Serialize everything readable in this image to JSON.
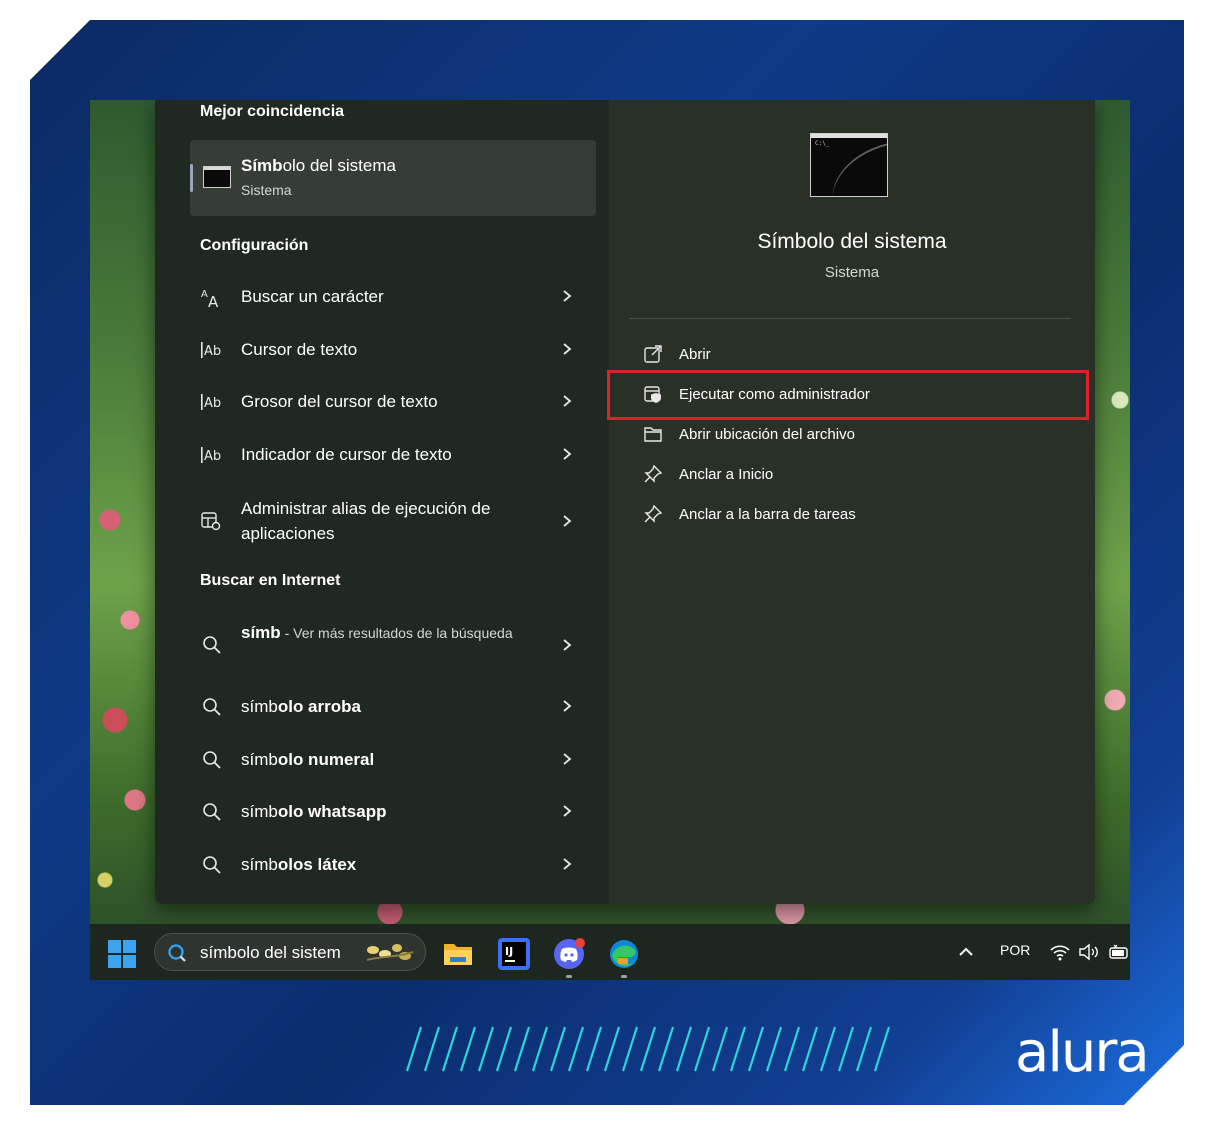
{
  "left": {
    "best_match_title": "Mejor coincidencia",
    "best_match": {
      "name": "Símbolo del sistema",
      "sub": "Sistema"
    },
    "config_title": "Configuración",
    "config_items": [
      {
        "label": "Buscar un carácter",
        "icon": "character-icon"
      },
      {
        "label": "Cursor de texto",
        "icon": "text-cursor-icon"
      },
      {
        "label": "Grosor del cursor de texto",
        "icon": "text-cursor-icon"
      },
      {
        "label": "Indicador de cursor de texto",
        "icon": "text-cursor-icon"
      },
      {
        "label": "Administrar alias de ejecución de aplicaciones",
        "icon": "app-alias-icon"
      }
    ],
    "web_title": "Buscar en Internet",
    "web_items": [
      {
        "bold": "símb",
        "rest": " - Ver más resultados de la búsqueda"
      },
      {
        "plain": "símb",
        "bold": "olo arroba"
      },
      {
        "plain": "símb",
        "bold": "olo numeral"
      },
      {
        "plain": "símb",
        "bold": "olo whatsapp"
      },
      {
        "plain": "símb",
        "bold": "olos látex"
      }
    ]
  },
  "right": {
    "app_title": "Símbolo del sistema",
    "app_sub": "Sistema",
    "actions": [
      {
        "label": "Abrir",
        "icon": "open-icon"
      },
      {
        "label": "Ejecutar como administrador",
        "icon": "admin-shield-icon"
      },
      {
        "label": "Abrir ubicación del archivo",
        "icon": "folder-icon"
      },
      {
        "label": "Anclar a Inicio",
        "icon": "pin-icon"
      },
      {
        "label": "Anclar a la barra de tareas",
        "icon": "pin-icon"
      }
    ]
  },
  "taskbar": {
    "search_text": "símbolo del sistema",
    "language": "POR",
    "apps": [
      "file-explorer-icon",
      "intellij-icon",
      "discord-icon",
      "edge-icon"
    ]
  },
  "brand": {
    "logo": "alura"
  },
  "colors": {
    "highlight": "#e0202a",
    "menu_bg": "#202822",
    "frame": "#0e3a86"
  }
}
